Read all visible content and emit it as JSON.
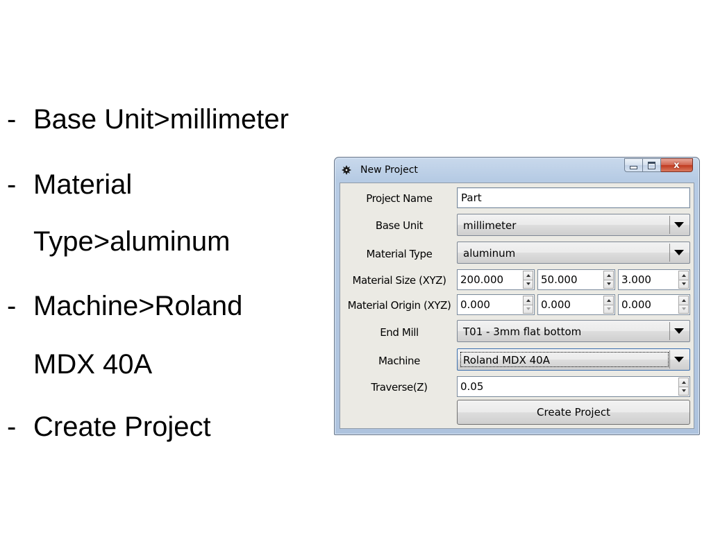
{
  "slide": {
    "bullets": [
      {
        "dash": "-",
        "lines": [
          "Base Unit>millimeter"
        ]
      },
      {
        "dash": "-",
        "lines": [
          "Material",
          "Type>aluminum"
        ]
      },
      {
        "dash": "-",
        "lines": [
          "Machine>Roland",
          "MDX 40A"
        ]
      },
      {
        "dash": "-",
        "lines": [
          "Create Project"
        ]
      }
    ]
  },
  "window": {
    "title": "New Project",
    "icon": "gear-cutter-icon",
    "caption_buttons": {
      "minimize": "minimize-icon",
      "maximize": "maximize-icon",
      "close": "x"
    }
  },
  "form": {
    "project_name": {
      "label": "Project Name",
      "value": "Part"
    },
    "base_unit": {
      "label": "Base Unit",
      "selected": "millimeter"
    },
    "material_type": {
      "label": "Material Type",
      "selected": "aluminum"
    },
    "material_size": {
      "label": "Material Size (XYZ)",
      "x": "200.000",
      "y": "50.000",
      "z": "3.000"
    },
    "material_origin": {
      "label": "Material Origin (XYZ)",
      "x": "0.000",
      "y": "0.000",
      "z": "0.000"
    },
    "end_mill": {
      "label": "End Mill",
      "selected": "T01 - 3mm flat bottom"
    },
    "machine": {
      "label": "Machine",
      "selected": "Roland MDX 40A"
    },
    "traverse": {
      "label": "Traverse(Z)",
      "value": "0.05"
    },
    "create_button": {
      "label": "Create Project"
    }
  }
}
